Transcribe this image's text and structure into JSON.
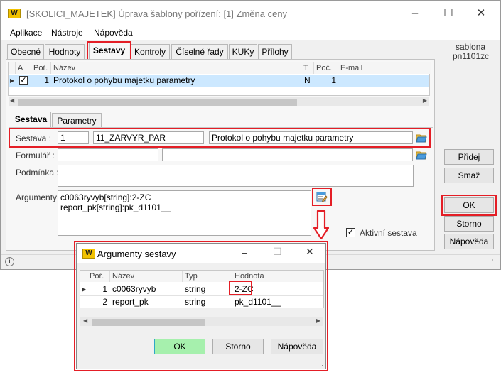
{
  "window": {
    "title": "[SKOLICI_MAJETEK] Úprava šablony pořízení: [1] Změna ceny",
    "logo": "W"
  },
  "menu": [
    "Aplikace",
    "Nástroje",
    "Nápověda"
  ],
  "tabs": [
    "Obecné",
    "Hodnoty",
    "Sestavy",
    "Kontroly",
    "Číselné řady",
    "KUKy",
    "Přílohy"
  ],
  "side": {
    "template_label": "sablona",
    "template_name": "pn1101zc"
  },
  "reports_grid": {
    "headers": [
      "A",
      "Poř.",
      "Název",
      "T",
      "Poč.",
      "E-mail"
    ],
    "rows": [
      {
        "poradi": "1",
        "nazev": "Protokol o pohybu majetku parametry",
        "t": "N",
        "poc": "1",
        "checked": true
      }
    ]
  },
  "subtabs": [
    "Sestava",
    "Parametry"
  ],
  "form": {
    "sestava_label": "Sestava :",
    "sestava_num": "1",
    "sestava_code": "11_ZARVYR_PAR",
    "sestava_name": "Protokol o pohybu majetku parametry",
    "formular_label": "Formulář :",
    "podminka_label": "Podmínka :",
    "argumenty_label": "Argumenty",
    "argumenty_line1": "c0063ryvyb[string]:2-ZC",
    "argumenty_line2": "report_pk[string]:pk_d1101__",
    "aktivni_label": "Aktivní sestava"
  },
  "buttons": {
    "pridej": "Přidej",
    "smaz": "Smaž",
    "ok": "OK",
    "storno": "Storno",
    "napoveda": "Nápověda"
  },
  "dialog": {
    "title": "Argumenty sestavy",
    "headers": [
      "Poř.",
      "Název",
      "Typ",
      "Hodnota"
    ],
    "rows": [
      {
        "poradi": "1",
        "nazev": "c0063ryvyb",
        "typ": "string",
        "hodnota": "2-ZC"
      },
      {
        "poradi": "2",
        "nazev": "report_pk",
        "typ": "string",
        "hodnota": "pk_d1101__"
      }
    ],
    "ok": "OK",
    "storno": "Storno",
    "napoveda": "Nápověda"
  },
  "colors": {
    "highlight": "#e41e26",
    "selected_row": "#cce8ff",
    "ok_green": "#a6f0ad"
  }
}
